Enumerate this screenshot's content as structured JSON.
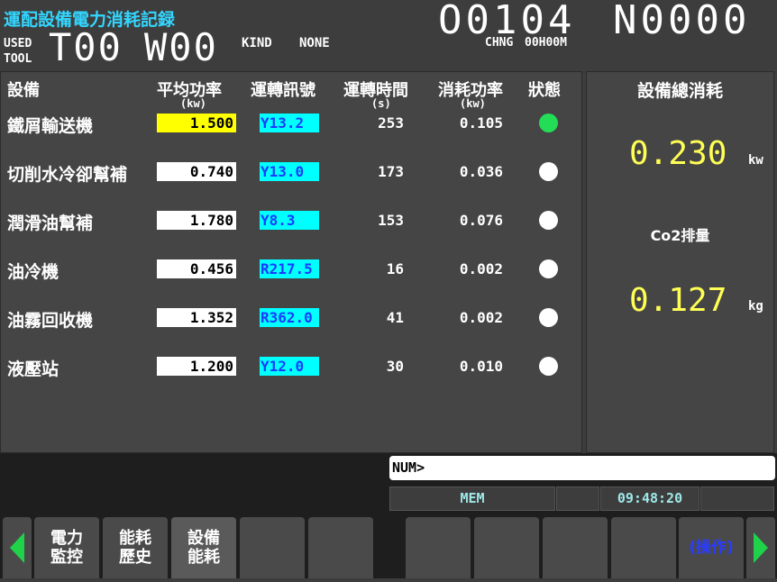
{
  "header": {
    "title": "運配設備電力消耗記録",
    "used_line1": "USED",
    "used_line2": "TOOL",
    "t_code": "T00",
    "w_code": "W00",
    "kind_label": "KIND",
    "kind_value": "NONE",
    "program_number": "O0104",
    "sequence_number": "N0000",
    "chng_label": "CHNG",
    "chng_value": "00H00M"
  },
  "table": {
    "columns": {
      "equipment": "設備",
      "avg_power": "平均功率",
      "avg_power_unit": "(kw)",
      "run_signal": "運轉訊號",
      "run_time": "運轉時間",
      "run_time_unit": "(s)",
      "consumed_power": "消耗功率",
      "consumed_power_unit": "(kw)",
      "status": "狀態"
    },
    "rows": [
      {
        "name": "鐵屑輸送機",
        "avg_power": "1.500",
        "signal": "Y13.2",
        "time": "253",
        "consumed": "0.105",
        "status_color": "#22dd55",
        "power_bg": "#ffff00"
      },
      {
        "name": "切削水冷卻幫補",
        "avg_power": "0.740",
        "signal": "Y13.0",
        "time": "173",
        "consumed": "0.036",
        "status_color": "#ffffff",
        "power_bg": "#ffffff"
      },
      {
        "name": "潤滑油幫補",
        "avg_power": "1.780",
        "signal": "Y8.3",
        "time": "153",
        "consumed": "0.076",
        "status_color": "#ffffff",
        "power_bg": "#ffffff"
      },
      {
        "name": "油冷機",
        "avg_power": "0.456",
        "signal": "R217.5",
        "time": "16",
        "consumed": "0.002",
        "status_color": "#ffffff",
        "power_bg": "#ffffff"
      },
      {
        "name": "油霧回收機",
        "avg_power": "1.352",
        "signal": "R362.0",
        "time": "41",
        "consumed": "0.002",
        "status_color": "#ffffff",
        "power_bg": "#ffffff"
      },
      {
        "name": "液壓站",
        "avg_power": "1.200",
        "signal": "Y12.0",
        "time": "30",
        "consumed": "0.010",
        "status_color": "#ffffff",
        "power_bg": "#ffffff"
      }
    ]
  },
  "summary": {
    "title": "設備總消耗",
    "power_value": "0.230",
    "power_unit": "kw",
    "co2_label": "Co2排量",
    "co2_value": "0.127",
    "co2_unit": "kg"
  },
  "input": {
    "value": "NUM>"
  },
  "status_bar": {
    "mode": "MEM",
    "time": "09:48:20"
  },
  "softkeys": {
    "key1": "電力\n監控",
    "key2": "能耗\n歷史",
    "key3": "設備\n能耗",
    "operate": "(操作)"
  },
  "colors": {
    "accent_title": "#33d6ff",
    "value_yellow": "#ffff55",
    "signal_bg": "#00ffff",
    "signal_text": "#1a3cff",
    "status_on": "#22dd55",
    "arrow_green": "#1fd24a"
  },
  "icons": {
    "left_arrow": "left-arrow-icon",
    "right_arrow": "right-arrow-icon"
  }
}
